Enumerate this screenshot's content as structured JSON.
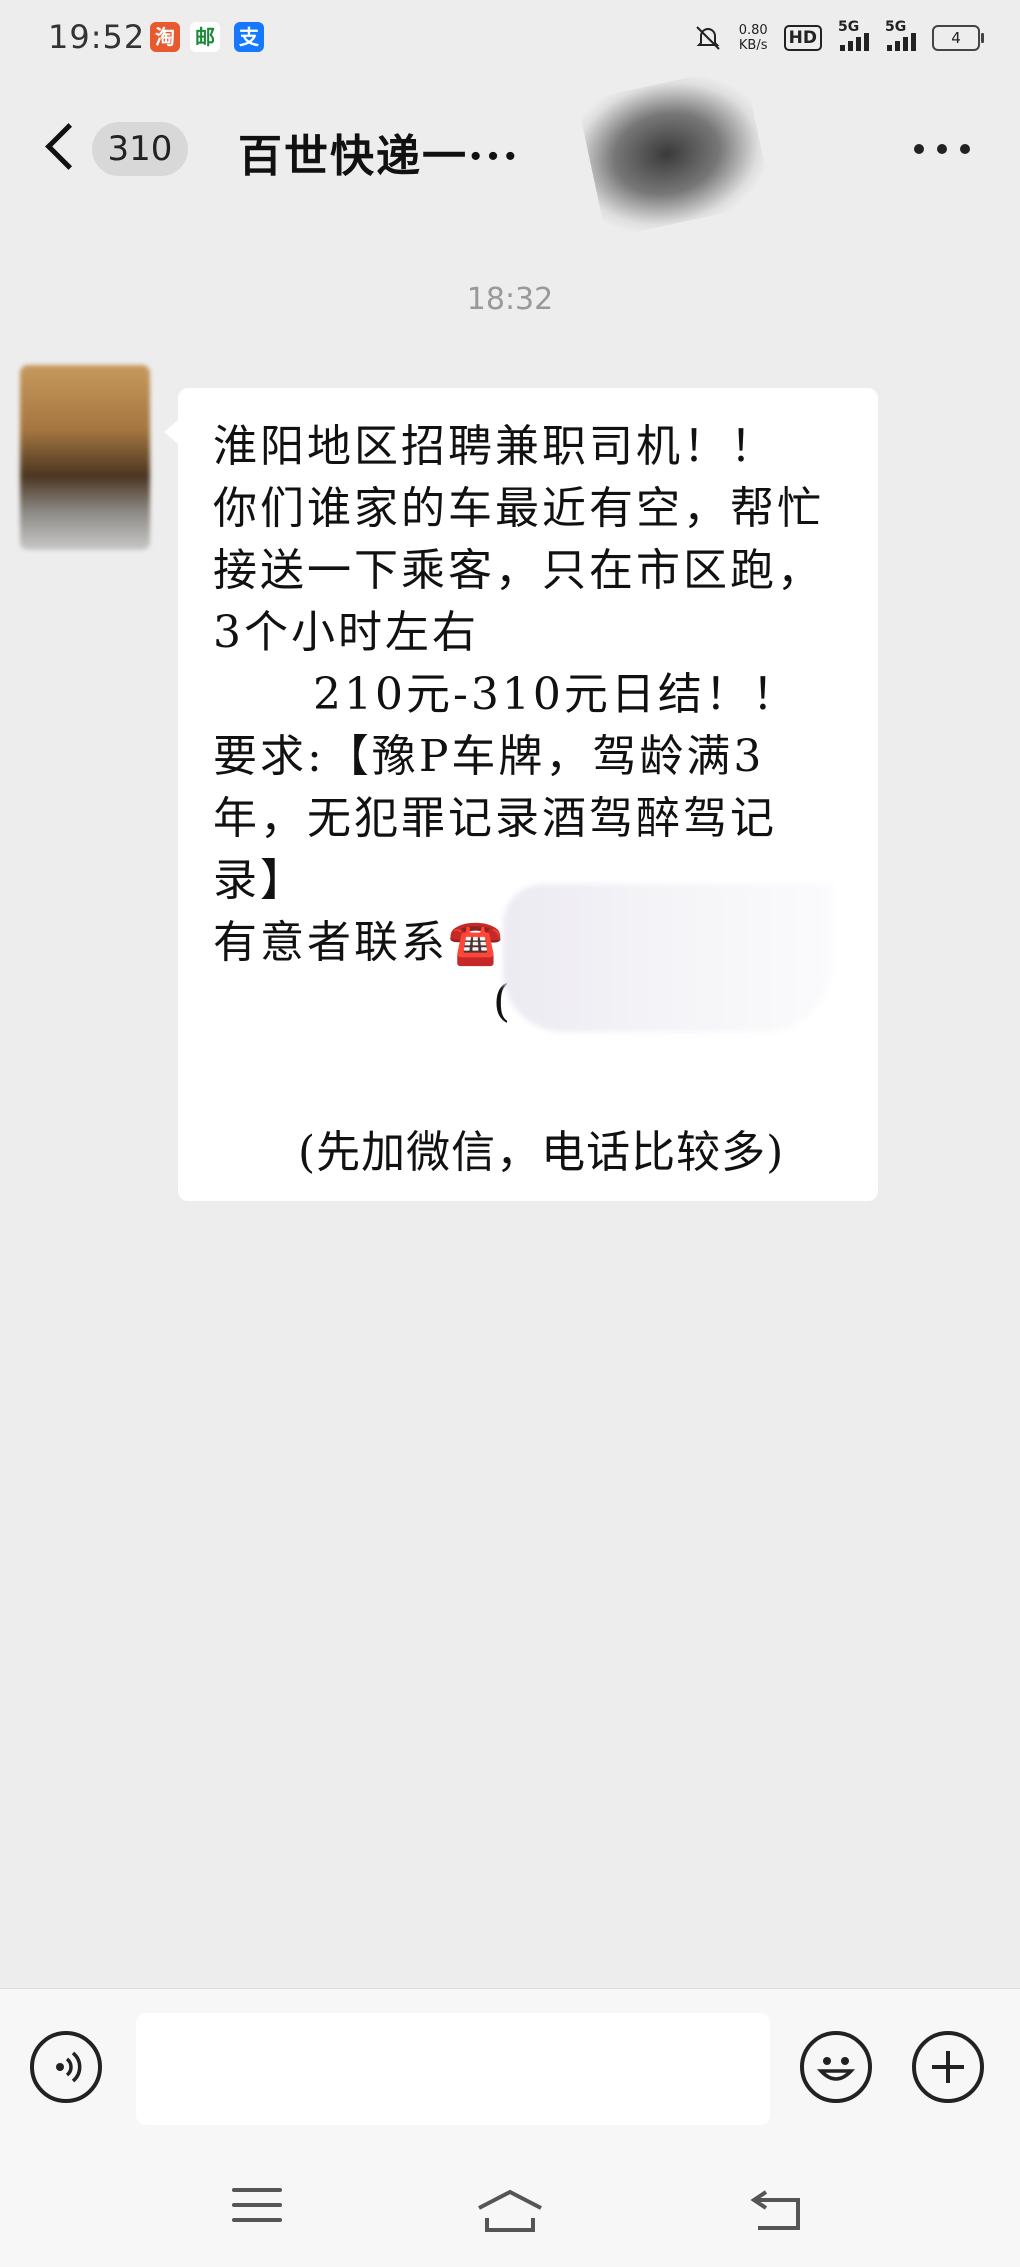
{
  "status": {
    "time": "19:52",
    "net_speed": "0.80",
    "net_unit": "KB/s",
    "hd_label": "HD",
    "sim_labels": [
      "5G",
      "5G"
    ],
    "battery": "4",
    "app_icons": [
      {
        "icon": "taobao-icon",
        "glyph": "淘",
        "color": "#e9592e"
      },
      {
        "icon": "post-icon",
        "glyph": "邮",
        "color": "#1a8a3a"
      },
      {
        "icon": "alipay-icon",
        "glyph": "支",
        "color": "#1677ff"
      }
    ]
  },
  "header": {
    "unread_count": "310",
    "title": "百世快递一···"
  },
  "chat": {
    "timestamp": "18:32",
    "message": {
      "lines": [
        "淮阳地区招聘兼职司机！！",
        "你们谁家的车最近有空，帮忙",
        "接送一下乘客，只在市区跑，",
        "3个小时左右",
        "210元-310元日结！！",
        "要求:【豫P车牌，驾龄满3",
        "年，无犯罪记录酒驾醉驾记",
        "录】",
        "有意者联系",
        "(",
        ")",
        "(先加微信，电话比较多)"
      ],
      "phone_emoji": "☎️"
    }
  },
  "colors": {
    "background": "#ededed",
    "bubble": "#ffffff",
    "timestamp": "#999999"
  }
}
